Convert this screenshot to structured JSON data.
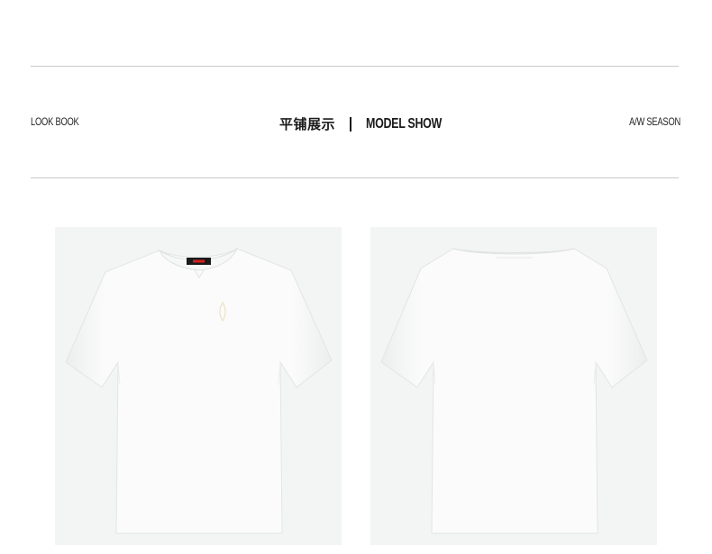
{
  "header": {
    "left_label": "LOOK BOOK",
    "title_cn": "平铺展示",
    "title_en": "MODEL SHOW",
    "right_label": "A/W SEASON"
  },
  "products": [
    {
      "view": "front",
      "label_icon": "brand-label-icon",
      "chest_icon": "embroidered-logo-icon"
    },
    {
      "view": "back"
    }
  ],
  "colors": {
    "background": "#ffffff",
    "photo_background": "#f3f4f4",
    "shirt": "#fdfdfd",
    "rule": "#c8c8c8",
    "label": "#1a1a1a",
    "label_accent": "#d42020"
  }
}
